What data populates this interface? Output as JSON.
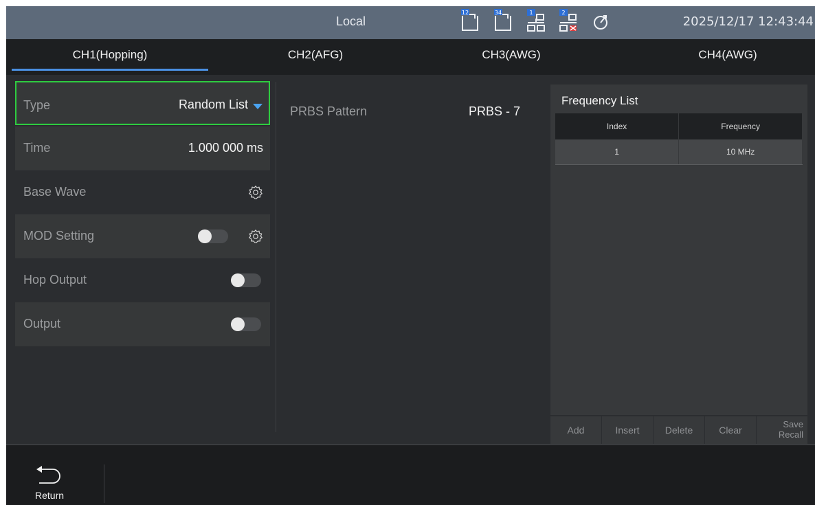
{
  "status": {
    "mode": "Local",
    "datetime": "2025/12/17 12:43:44",
    "icons": [
      "usb-12-icon",
      "usb-34-icon",
      "network-1-icon",
      "network-2-disconnected-icon",
      "timer-icon"
    ],
    "icon_badges": [
      "12",
      "34",
      "1",
      "2"
    ]
  },
  "tabs": [
    {
      "label": "CH1(Hopping)",
      "active": true
    },
    {
      "label": "CH2(AFG)",
      "active": false
    },
    {
      "label": "CH3(AWG)",
      "active": false
    },
    {
      "label": "CH4(AWG)",
      "active": false
    }
  ],
  "settings": {
    "type": {
      "label": "Type",
      "value": "Random List"
    },
    "time": {
      "label": "Time",
      "value": "1.000 000 ms"
    },
    "base_wave": {
      "label": "Base Wave"
    },
    "mod_setting": {
      "label": "MOD Setting",
      "enabled": false
    },
    "hop_output": {
      "label": "Hop Output",
      "enabled": false
    },
    "output": {
      "label": "Output",
      "enabled": false
    }
  },
  "prbs": {
    "label": "PRBS Pattern",
    "value": "PRBS - 7"
  },
  "frequency_list": {
    "title": "Frequency List",
    "columns": [
      "Index",
      "Frequency"
    ],
    "rows": [
      [
        "1",
        "10 MHz"
      ]
    ],
    "buttons": {
      "add": "Add",
      "insert": "Insert",
      "delete": "Delete",
      "clear": "Clear",
      "save_recall_line1": "Save",
      "save_recall_line2": "Recall"
    }
  },
  "bottom": {
    "return_label": "Return"
  },
  "colors": {
    "accent": "#4a90e2",
    "focus": "#2ecc40",
    "statusbar": "#5d6a7a"
  }
}
